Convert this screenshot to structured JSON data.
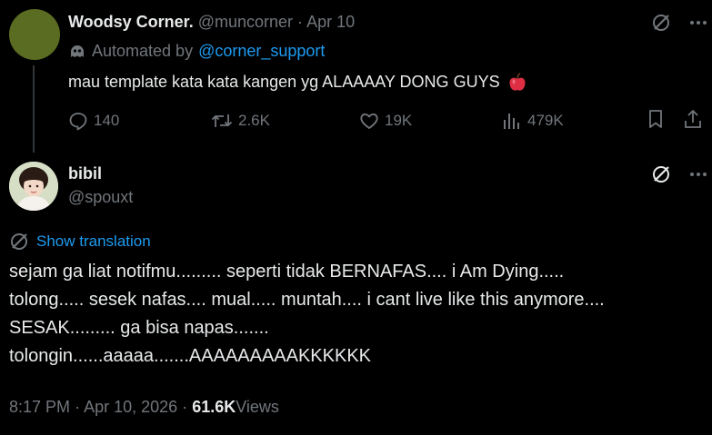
{
  "parent_tweet": {
    "author_name": "Woodsy Corner.",
    "author_handle": "@muncorner",
    "separator": "·",
    "date": "Apr 10",
    "automated_prefix": "Automated by",
    "automated_account": "@corner_support",
    "text": "mau template kata kata kangen yg ALAAAAY DONG GUYS",
    "stats": {
      "replies": "140",
      "reposts": "2.6K",
      "likes": "19K",
      "views": "479K"
    }
  },
  "reply_tweet": {
    "author_name": "bibil",
    "author_handle": "@spouxt",
    "translate_label": "Show translation",
    "lines": [
      "sejam ga liat notifmu......... seperti tidak BERNAFAS.... i Am Dying.....",
      "tolong..... sesek nafas.... mual..... muntah.... i cant live like this anymore....",
      "SESAK......... ga bisa napas.......",
      "tolongin......aaaaa.......AAAAAAAAAKKKKKK"
    ],
    "time": "8:17 PM",
    "separator": "·",
    "date": "Apr 10, 2026",
    "meta_separator": "·",
    "views_count": "61.6K",
    "views_label": "Views"
  },
  "colors": {
    "background": "#000000",
    "text": "#e7e9ea",
    "muted": "#71767b",
    "link": "#1d9bf0",
    "parent_avatar": "#5a6b22"
  },
  "icons": [
    "grok-icon",
    "more-icon",
    "bot-icon",
    "apple-emoji",
    "reply-icon",
    "repost-icon",
    "like-icon",
    "views-icon",
    "bookmark-icon",
    "share-icon",
    "translate-icon"
  ]
}
